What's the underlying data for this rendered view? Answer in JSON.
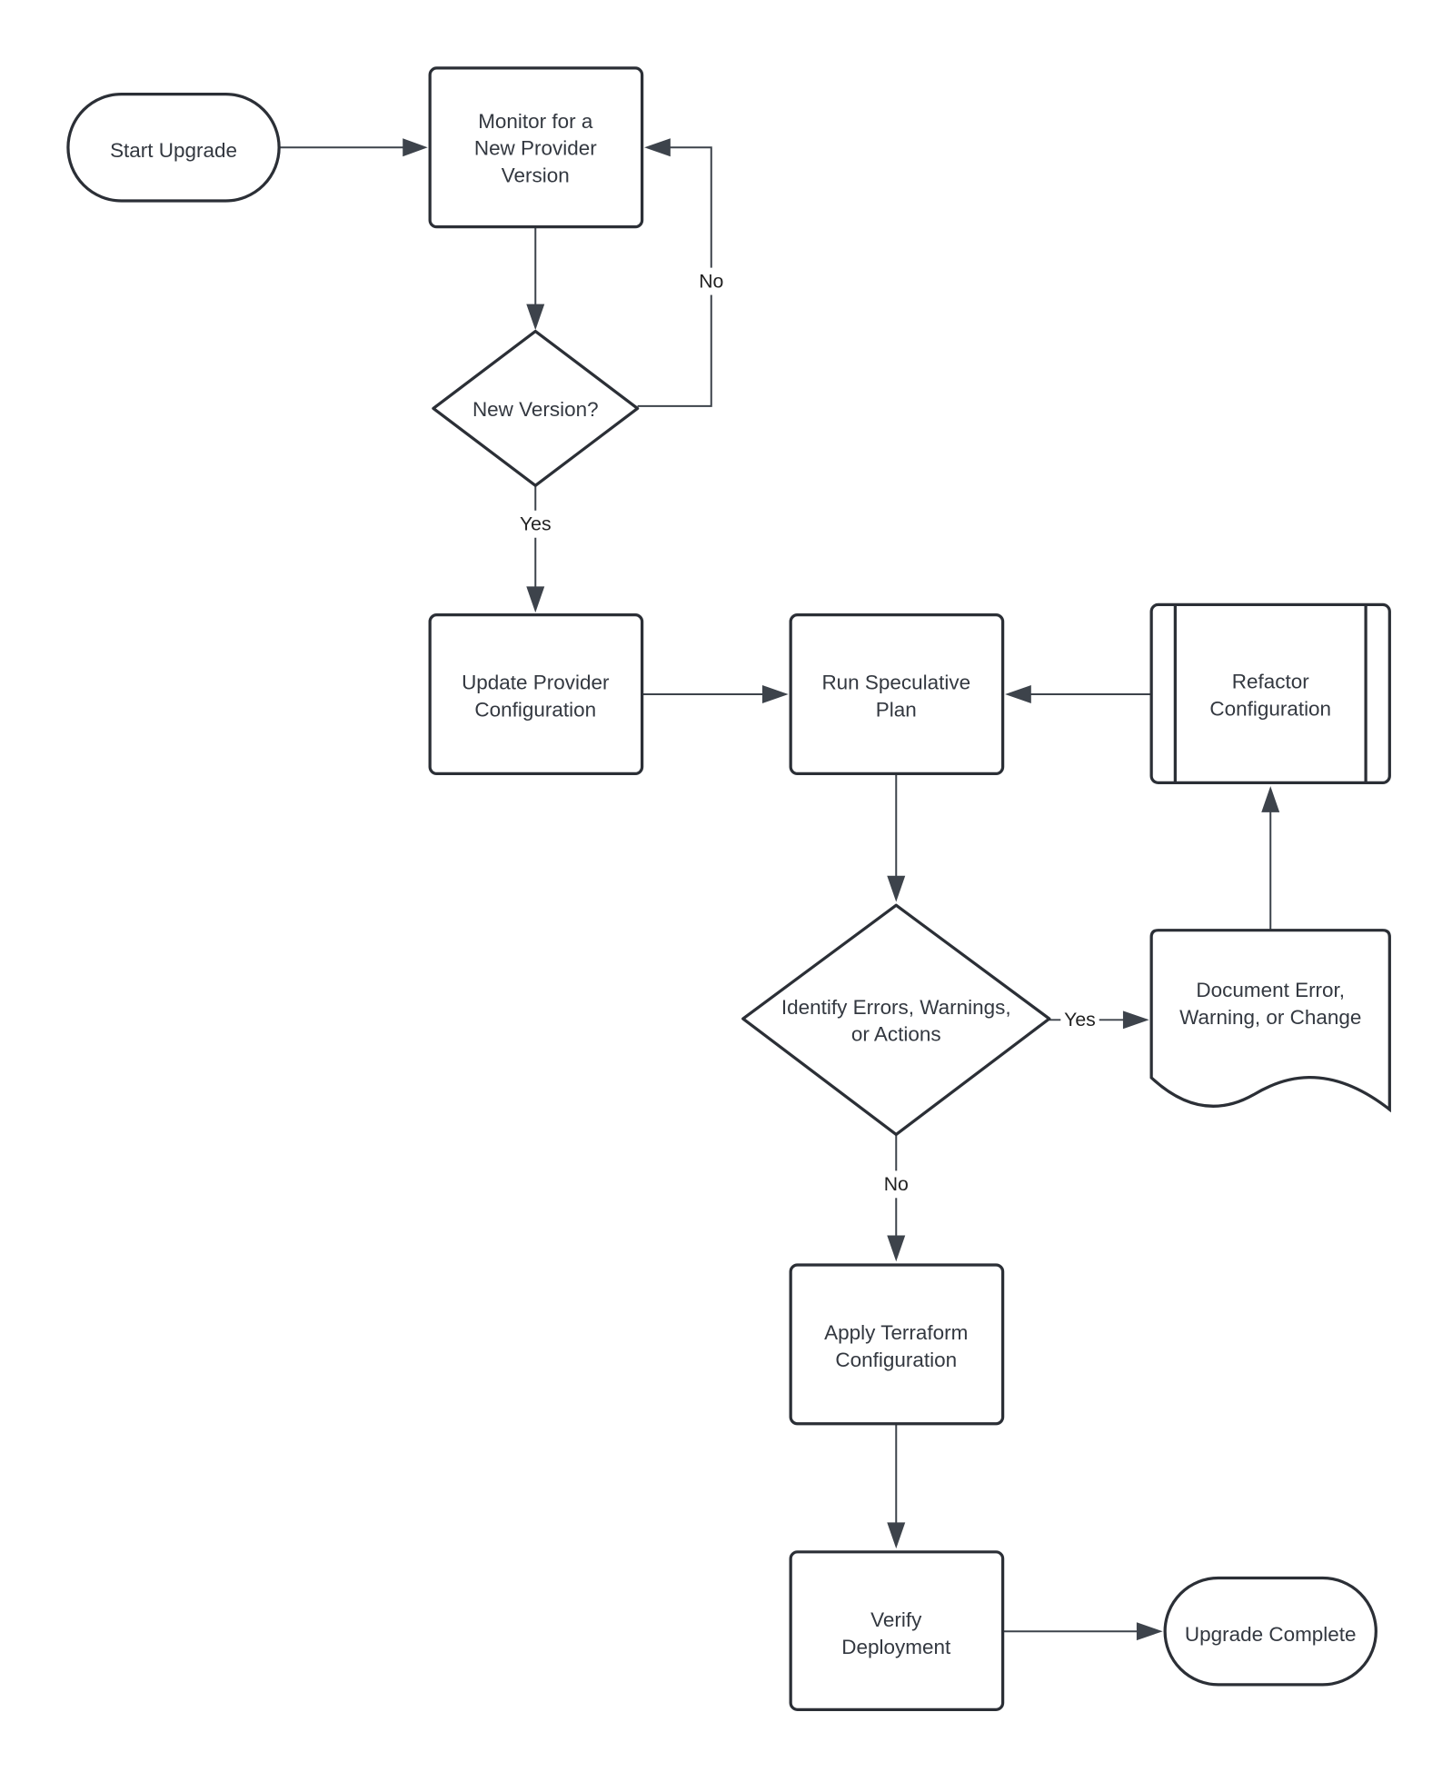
{
  "colors": {
    "stroke": "#2b2f36",
    "arrow": "#3d434b",
    "text": "#333840",
    "background": "#ffffff"
  },
  "nodes": {
    "start": {
      "lines": [
        "Start Upgrade"
      ],
      "shape": "terminator"
    },
    "monitor": {
      "lines": [
        "Monitor for a",
        "New Provider",
        "Version"
      ],
      "shape": "process"
    },
    "new_version": {
      "lines": [
        "New Version?"
      ],
      "shape": "decision"
    },
    "update_provider": {
      "lines": [
        "Update Provider",
        "Configuration"
      ],
      "shape": "process"
    },
    "run_plan": {
      "lines": [
        "Run Speculative",
        "Plan"
      ],
      "shape": "process"
    },
    "refactor": {
      "lines": [
        "Refactor",
        "Configuration"
      ],
      "shape": "predefined-process"
    },
    "identify": {
      "lines": [
        "Identify Errors, Warnings,",
        "or Actions"
      ],
      "shape": "decision"
    },
    "document": {
      "lines": [
        "Document Error,",
        "Warning, or Change"
      ],
      "shape": "document"
    },
    "apply": {
      "lines": [
        "Apply Terraform",
        "Configuration"
      ],
      "shape": "process"
    },
    "verify": {
      "lines": [
        "Verify",
        "Deployment"
      ],
      "shape": "process"
    },
    "complete": {
      "lines": [
        "Upgrade Complete"
      ],
      "shape": "terminator"
    }
  },
  "edges": {
    "new_version_no": "No",
    "new_version_yes": "Yes",
    "identify_yes": "Yes",
    "identify_no": "No"
  }
}
